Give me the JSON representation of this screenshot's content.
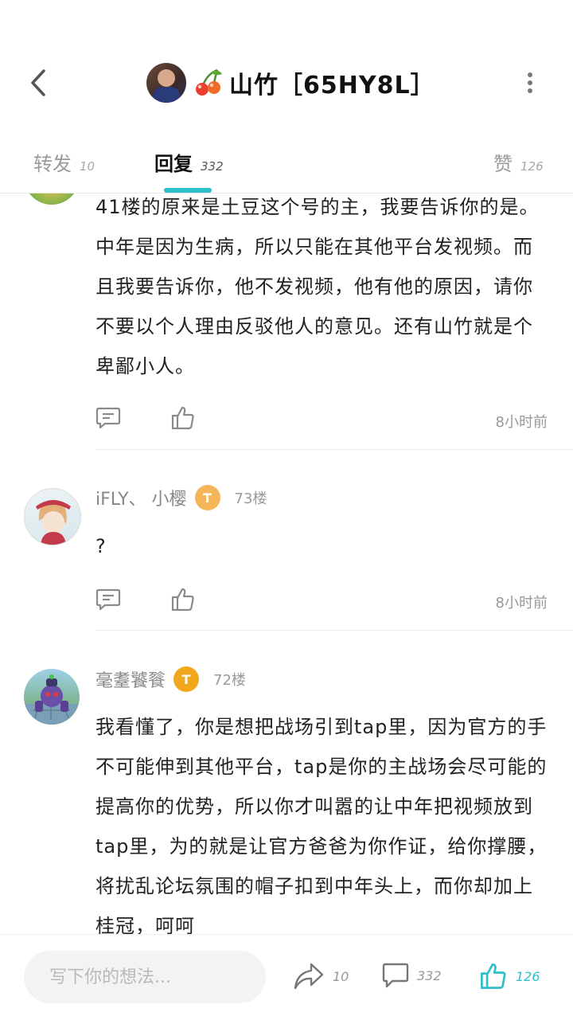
{
  "header": {
    "title": "山竹［65HY8L］"
  },
  "tabs": [
    {
      "label": "转发",
      "count": "10"
    },
    {
      "label": "回复",
      "count": "332"
    },
    {
      "label": "赞",
      "count": "126"
    }
  ],
  "comments": [
    {
      "text": "41楼的原来是土豆这个号的主，我要告诉你的是。中年是因为生病，所以只能在其他平台发视频。而且我要告诉你，他不发视频，他有他的原因，请你不要以个人理由反驳他人的意见。还有山竹就是个卑鄙小人。",
      "time": "8小时前"
    },
    {
      "username": "iFLY、 小樱",
      "badge": "T",
      "floor": "73楼",
      "text": "?",
      "time": "8小时前"
    },
    {
      "username": "毫耋饕餮",
      "badge": "T",
      "floor": "72楼",
      "text": "我看懂了，你是想把战场引到tap里，因为官方的手不可能伸到其他平台，tap是你的主战场会尽可能的提高你的优势，所以你才叫嚣的让中年把视频放到tap里，为的就是让官方爸爸为你作证，给你撑腰，将扰乱论坛氛围的帽子扣到中年头上，而你却加上桂冠，呵呵"
    }
  ],
  "bottom_bar": {
    "input_placeholder": "写下你的想法...",
    "share_count": "10",
    "comment_count": "332",
    "like_count": "126"
  },
  "colors": {
    "accent": "#2fbfc8",
    "badge_orange": "#f5b65a",
    "badge_gold": "#f2a81c"
  }
}
